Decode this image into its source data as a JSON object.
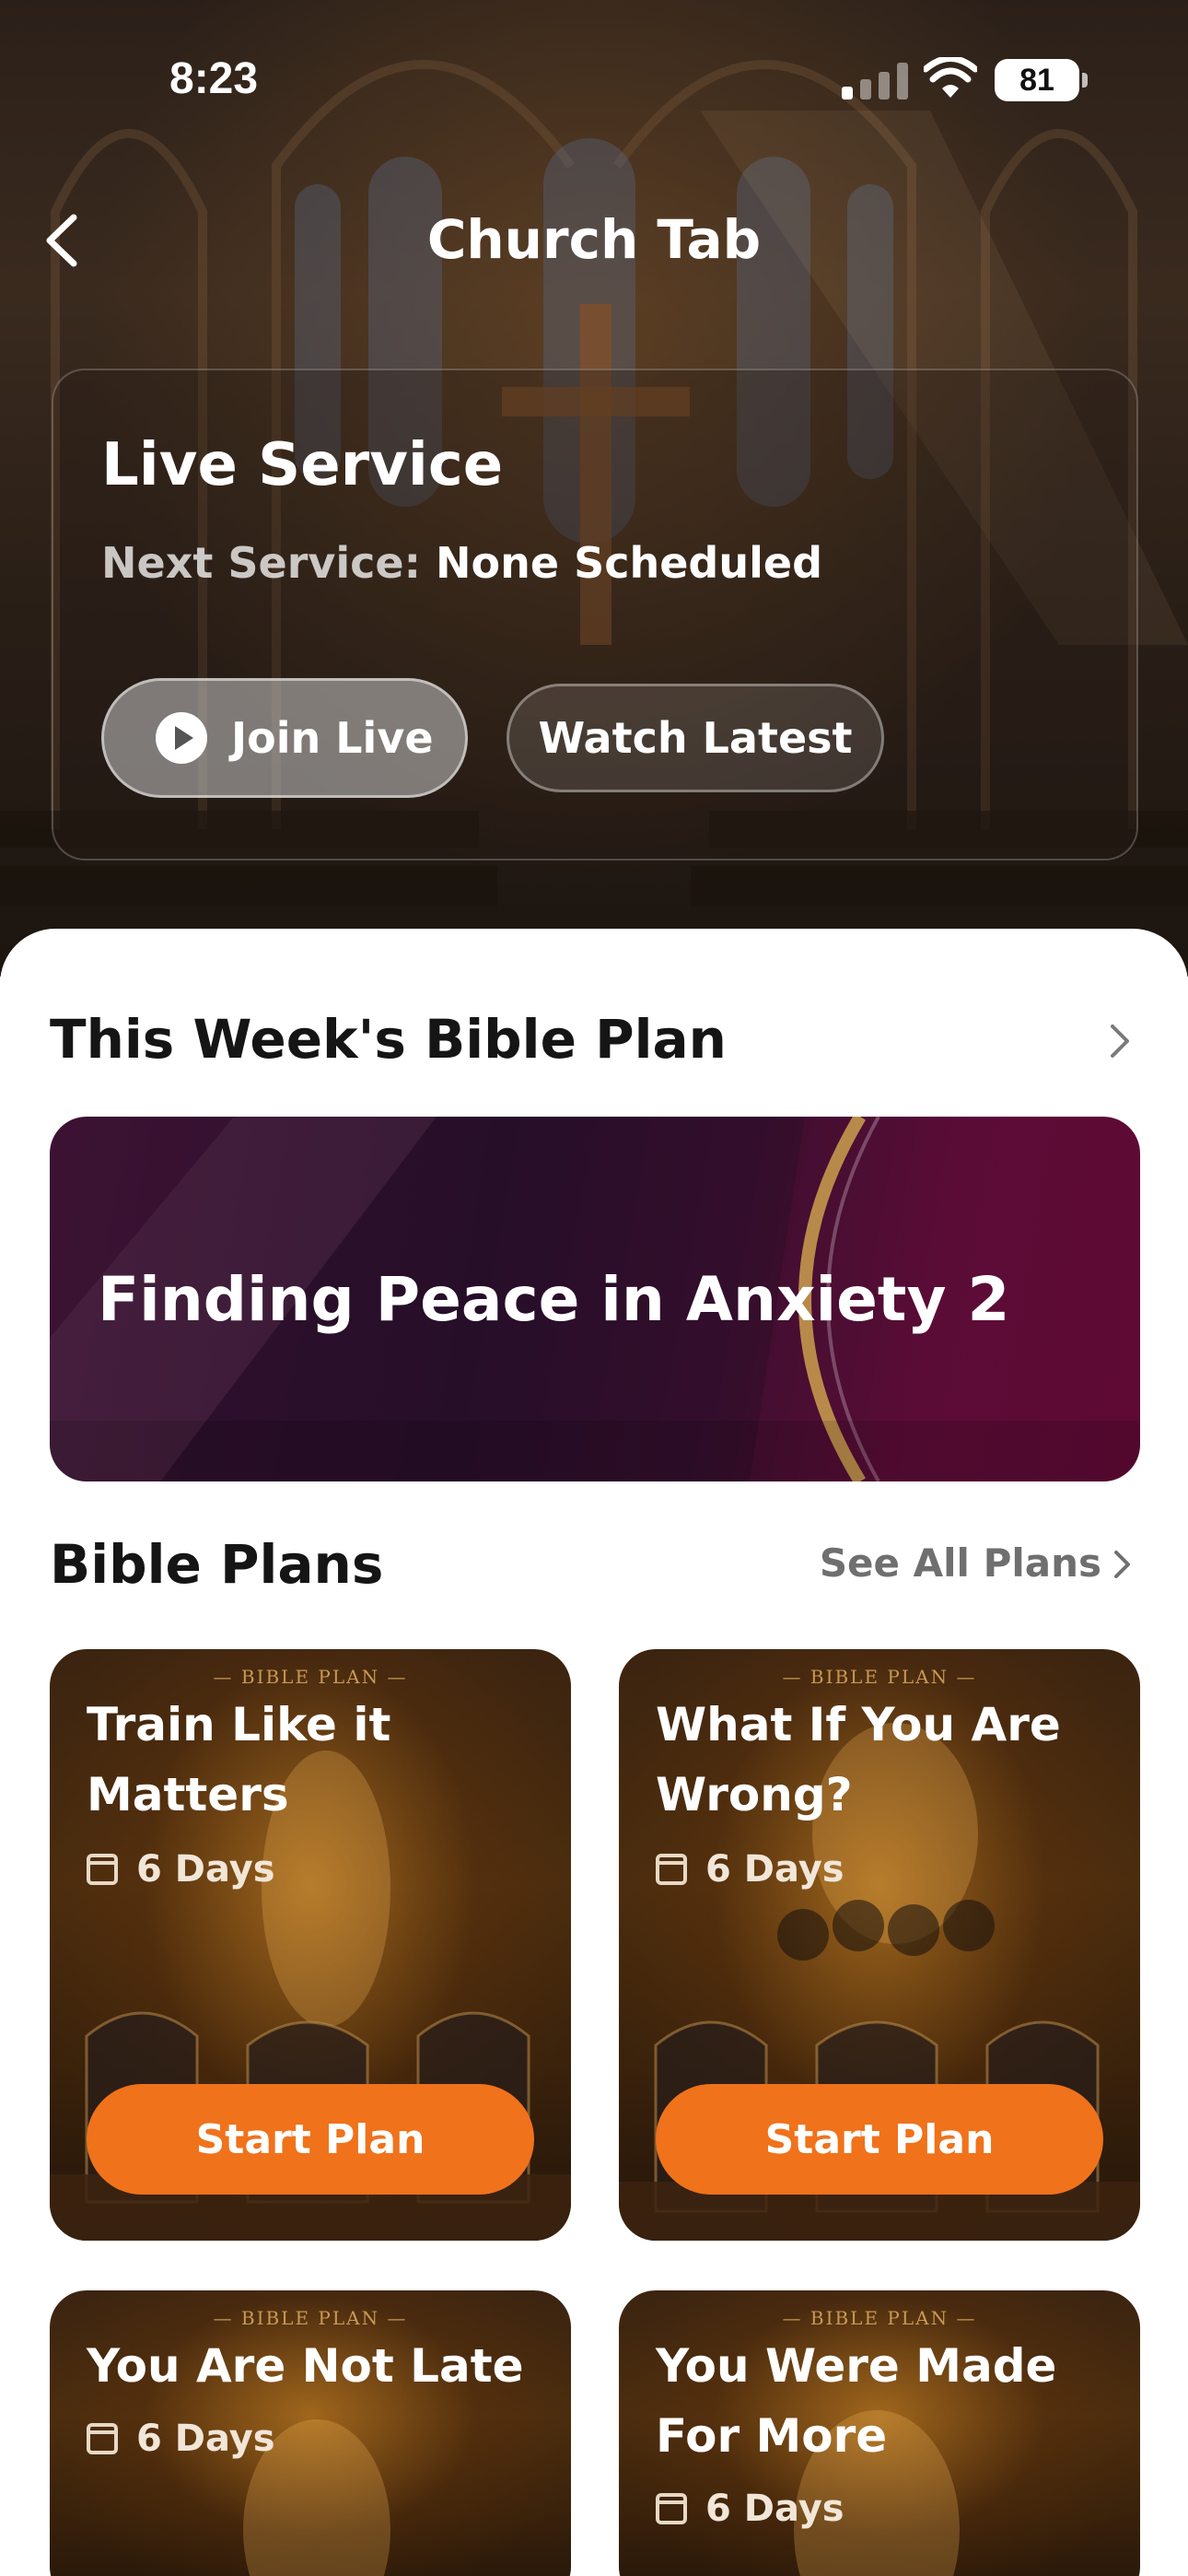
{
  "status_bar": {
    "time": "8:23",
    "battery": "81"
  },
  "header": {
    "title": "Church Tab"
  },
  "live_service": {
    "title": "Live Service",
    "next_label": "Next Service:",
    "next_value": "None Scheduled",
    "join_label": "Join Live",
    "watch_label": "Watch Latest"
  },
  "weekly_plan": {
    "section_title": "This Week's Bible Plan",
    "banner_title": "Finding Peace in Anxiety 2"
  },
  "bible_plans": {
    "section_title": "Bible Plans",
    "see_all": "See All Plans",
    "kicker": "— BIBLE PLAN —",
    "items": [
      {
        "title": "Train Like it Matters",
        "days": "6 Days",
        "button": "Start Plan"
      },
      {
        "title": "What If You Are Wrong?",
        "days": "6 Days",
        "button": "Start Plan"
      },
      {
        "title": "You Are Not Late",
        "days": "6 Days"
      },
      {
        "title": "You Were Made For More",
        "days": "6 Days"
      }
    ]
  },
  "colors": {
    "accent": "#f0721b",
    "banner": "#5b0c36"
  }
}
